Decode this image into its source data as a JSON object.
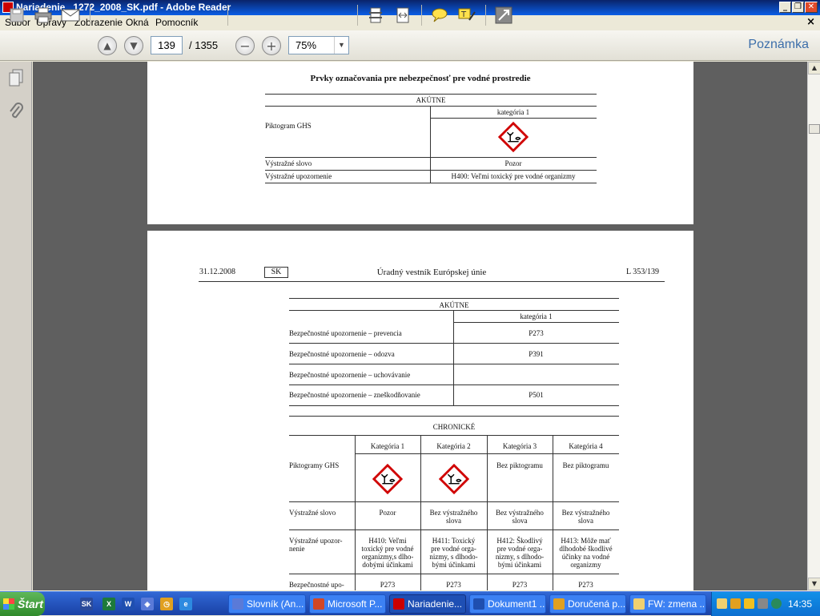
{
  "window": {
    "title": "Nariadenie _1272_2008_SK.pdf - Adobe Reader"
  },
  "menu": [
    "Súbor",
    "Úpravy",
    "Zobrazenie",
    "Okná",
    "Pomocník"
  ],
  "toolbar": {
    "page_current": "139",
    "page_total": "/ 1355",
    "zoom": "75%",
    "comment_label": "Poznámka"
  },
  "page1": {
    "heading": "Prvky označovania pre nebezpečnosť pre vodné prostredie",
    "table": {
      "section": "AKÚTNE",
      "category": "kategória 1",
      "rows": [
        {
          "label": "Piktogram GHS",
          "value": ""
        },
        {
          "label": "Výstražné slovo",
          "value": "Pozor"
        },
        {
          "label": "Výstražné upozornenie",
          "value": "H400: Veľmi toxický pre vodné organizmy"
        }
      ]
    }
  },
  "page2": {
    "header": {
      "date": "31.12.2008",
      "lang": "SK",
      "journal": "Úradný vestník Európskej únie",
      "ref": "L 353/139"
    },
    "acute": {
      "section": "AKÚTNE",
      "category": "kategória 1",
      "rows": [
        {
          "label": "Bezpečnostné upozornenie – prevencia",
          "value": "P273"
        },
        {
          "label": "Bezpečnostné upozornenie – odozva",
          "value": "P391"
        },
        {
          "label": "Bezpečnostné upozornenie – uchovávanie",
          "value": ""
        },
        {
          "label": "Bezpečnostné upozornenie – zneškodňovanie",
          "value": "P501"
        }
      ]
    },
    "chronic": {
      "section": "CHRONICKÉ",
      "categories": [
        "Kategória 1",
        "Kategória 2",
        "Kategória 3",
        "Kategória 4"
      ],
      "pictogram_label": "Piktogramy GHS",
      "no_pictogram": [
        "Bez piktogramu",
        "Bez piktogramu"
      ],
      "signal_label": "Výstražné slovo",
      "signal": [
        "Pozor",
        [
          "Bez výstražného",
          "slova"
        ],
        [
          "Bez výstražného",
          "slova"
        ],
        [
          "Bez výstražného",
          "slova"
        ]
      ],
      "hazard_label": [
        "Výstražné upozor-",
        "nenie"
      ],
      "hazard": [
        [
          "H410: Veľmi",
          "toxický pre vodné",
          "organizmy,s dlho-",
          "dobými účinkami"
        ],
        [
          "H411: Toxický",
          "pre vodné orga-",
          "nizmy, s dlhodo-",
          "bými účinkami"
        ],
        [
          "H412: Škodlivý",
          "pre vodné orga-",
          "nizmy, s dlhodo-",
          "bými účinkami"
        ],
        [
          "H413: Môže mať",
          "dlhodobé škodlivé",
          "účinky na vodné",
          "organizmy"
        ]
      ],
      "precaution_label": "Bezpečnostné upo-",
      "precaution": [
        "P273",
        "P273",
        "P273",
        "P273"
      ]
    }
  },
  "taskbar": {
    "start": "Štart",
    "tasks": [
      "Slovník (An...",
      "Microsoft P...",
      "Nariadenie...",
      "Dokument1 ...",
      "Doručená p...",
      "FW: zmena ..."
    ],
    "clock": "14:35"
  },
  "colors": {
    "titlebar": "#0a5ee6",
    "taskbar": "#245edb",
    "start": "#3c9c38",
    "ghs_border": "#d00000"
  }
}
